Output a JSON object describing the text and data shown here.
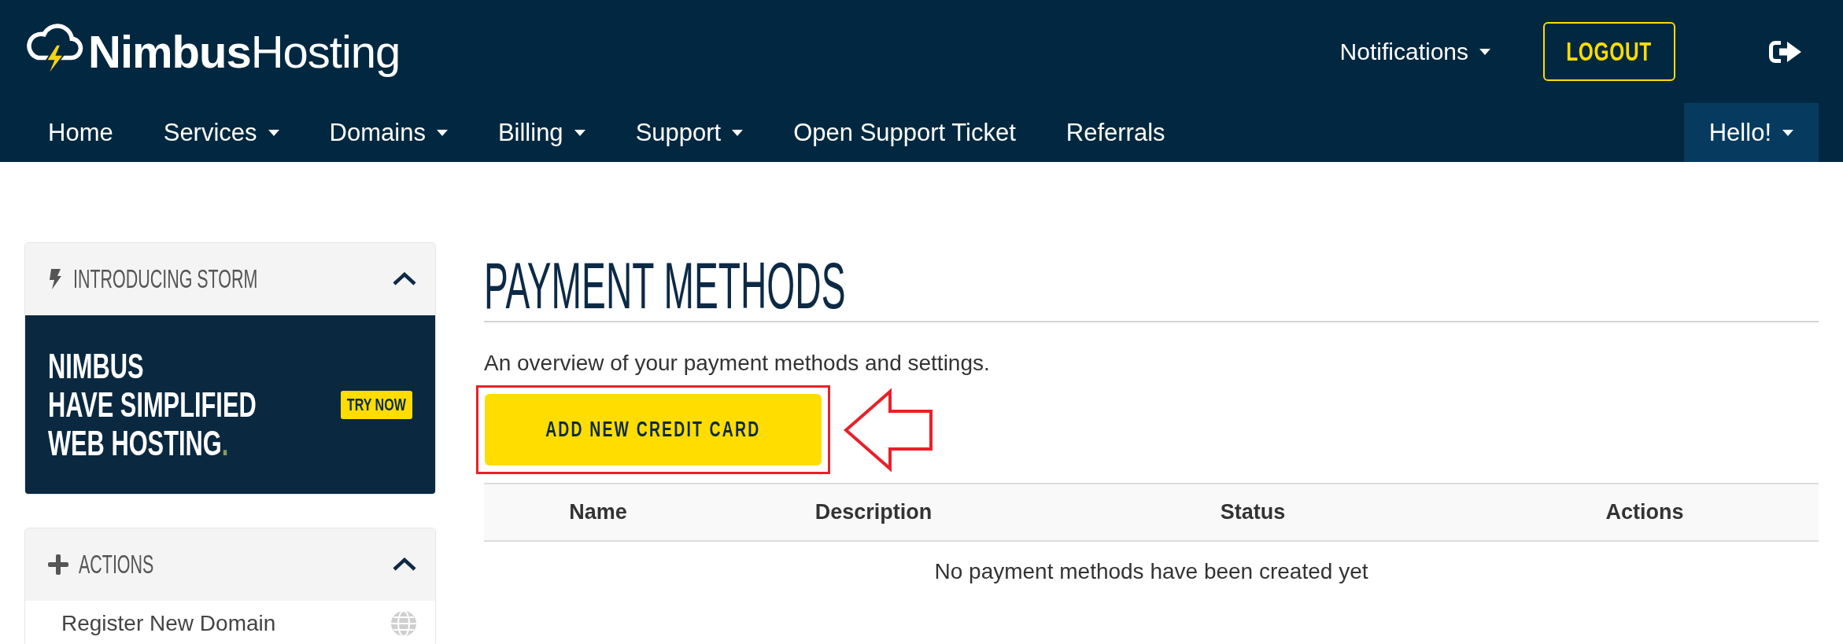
{
  "header": {
    "logo": "**Nimbus**Hosting",
    "notifications": {
      "label": "Notifications",
      "has_menu": true
    },
    "logout": "LOGOUT"
  },
  "nav": {
    "items": [
      {
        "label": "Home",
        "has_menu": false
      },
      {
        "label": "Services",
        "has_menu": true
      },
      {
        "label": "Domains",
        "has_menu": true
      },
      {
        "label": "Billing",
        "has_menu": true
      },
      {
        "label": "Support",
        "has_menu": true
      },
      {
        "label": "Open Support Ticket",
        "has_menu": false
      },
      {
        "label": "Referrals",
        "has_menu": false
      }
    ],
    "user_menu": {
      "label": "Hello!",
      "has_menu": true
    }
  },
  "sidebar": {
    "panels": [
      {
        "kind": "promo",
        "title": "INTRODUCING STORM",
        "expanded": true,
        "banner": {
          "lines": [
            "NIMBUS",
            "HAVE SIMPLIFIED",
            "WEB HOSTING"
          ],
          "accent": ".",
          "cta": "TRY NOW"
        }
      },
      {
        "kind": "actions",
        "title": "ACTIONS",
        "expanded": true,
        "items": [
          {
            "label": "Register New Domain"
          }
        ]
      }
    ]
  },
  "main": {
    "title": "PAYMENT METHODS",
    "description": "An overview of your payment methods and settings.",
    "add_button": {
      "label": "ADD NEW CREDIT CARD",
      "highlighted": true
    },
    "table": {
      "columns": [
        "Name",
        "Description",
        "Status",
        "Actions"
      ],
      "empty_message": "No payment methods have been created yet"
    }
  }
}
